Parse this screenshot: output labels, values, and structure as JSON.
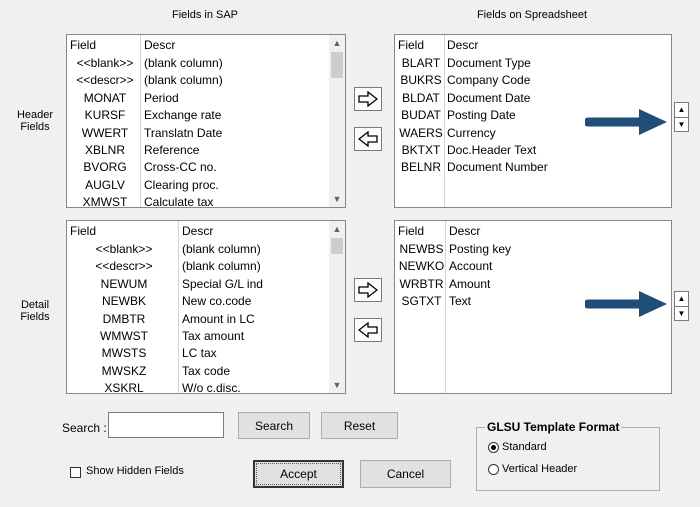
{
  "columns": {
    "sap_title": "Fields in SAP",
    "spreadsheet_title": "Fields on Spreadsheet"
  },
  "sections": {
    "header_label_1": "Header",
    "header_label_2": "Fields",
    "detail_label_1": "Detail",
    "detail_label_2": "Fields"
  },
  "lists": {
    "header_sap": {
      "col_field": "Field",
      "col_descr": "Descr",
      "rows": [
        {
          "field": "<<blank>>",
          "descr": "(blank column)"
        },
        {
          "field": "<<descr>>",
          "descr": "(blank column)"
        },
        {
          "field": "MONAT",
          "descr": "Period"
        },
        {
          "field": "KURSF",
          "descr": "Exchange rate"
        },
        {
          "field": "WWERT",
          "descr": "Translatn Date"
        },
        {
          "field": "XBLNR",
          "descr": "Reference"
        },
        {
          "field": "BVORG",
          "descr": "Cross-CC no."
        },
        {
          "field": "AUGLV",
          "descr": "Clearing proc."
        },
        {
          "field": "XMWST",
          "descr": "Calculate tax"
        }
      ]
    },
    "header_sheet": {
      "col_field": "Field",
      "col_descr": "Descr",
      "rows": [
        {
          "field": "BLART",
          "descr": "Document Type"
        },
        {
          "field": "BUKRS",
          "descr": "Company Code"
        },
        {
          "field": "BLDAT",
          "descr": "Document Date"
        },
        {
          "field": "BUDAT",
          "descr": "Posting Date"
        },
        {
          "field": "WAERS",
          "descr": "Currency"
        },
        {
          "field": "BKTXT",
          "descr": "Doc.Header Text"
        },
        {
          "field": "BELNR",
          "descr": "Document Number"
        }
      ]
    },
    "detail_sap": {
      "col_field": "Field",
      "col_descr": "Descr",
      "rows": [
        {
          "field": "<<blank>>",
          "descr": "(blank column)"
        },
        {
          "field": "<<descr>>",
          "descr": "(blank column)"
        },
        {
          "field": "NEWUM",
          "descr": "Special G/L ind"
        },
        {
          "field": "NEWBK",
          "descr": "New co.code"
        },
        {
          "field": "DMBTR",
          "descr": "Amount in LC"
        },
        {
          "field": "WMWST",
          "descr": "Tax amount"
        },
        {
          "field": "MWSTS",
          "descr": "LC tax"
        },
        {
          "field": "MWSKZ",
          "descr": "Tax code"
        },
        {
          "field": "XSKRL",
          "descr": "W/o c.disc."
        }
      ]
    },
    "detail_sheet": {
      "col_field": "Field",
      "col_descr": "Descr",
      "rows": [
        {
          "field": "NEWBS",
          "descr": "Posting key"
        },
        {
          "field": "NEWKO",
          "descr": "Account"
        },
        {
          "field": "WRBTR",
          "descr": "Amount"
        },
        {
          "field": "SGTXT",
          "descr": "Text"
        }
      ]
    }
  },
  "search": {
    "label": "Search :",
    "value": "",
    "search_button": "Search",
    "reset_button": "Reset"
  },
  "options": {
    "show_hidden_label": "Show Hidden Fields",
    "show_hidden_checked": false
  },
  "actions": {
    "accept": "Accept",
    "cancel": "Cancel"
  },
  "template_format": {
    "title": "GLSU Template Format",
    "standard": "Standard",
    "vertical": "Vertical Header",
    "selected": "standard"
  },
  "colors": {
    "arrow_annotation": "#1f4e79"
  },
  "icons": {
    "move_right": "right-arrow-outline-icon",
    "move_left": "left-arrow-outline-icon",
    "spin_up": "triangle-up-icon",
    "spin_down": "triangle-down-icon",
    "annotation": "blue-arrow-icon"
  }
}
